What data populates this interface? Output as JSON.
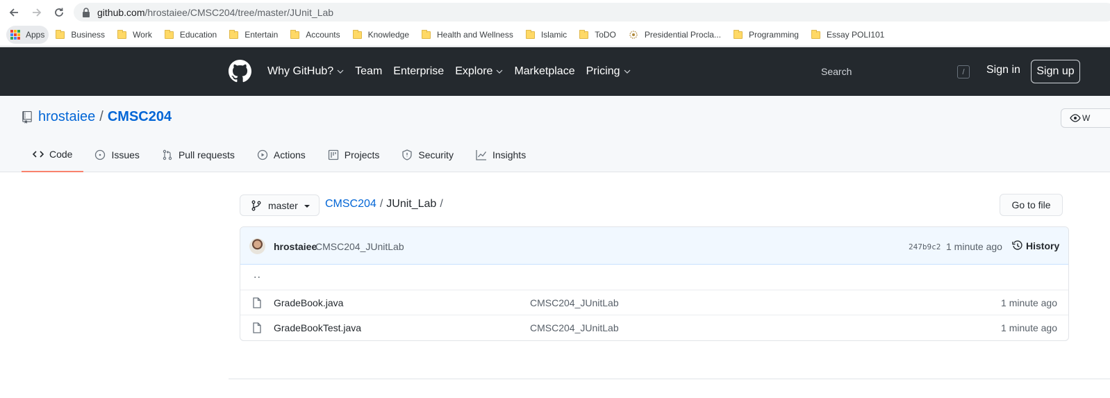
{
  "browser": {
    "url_host": "github.com",
    "url_path": "/hrostaiee/CMSC204/tree/master/JUnit_Lab",
    "bookmarks": [
      {
        "label": "Apps",
        "type": "apps"
      },
      {
        "label": "Business",
        "type": "folder"
      },
      {
        "label": "Work",
        "type": "folder"
      },
      {
        "label": "Education",
        "type": "folder"
      },
      {
        "label": "Entertain",
        "type": "folder"
      },
      {
        "label": "Accounts",
        "type": "folder"
      },
      {
        "label": "Knowledge",
        "type": "folder"
      },
      {
        "label": "Health and Wellness",
        "type": "folder"
      },
      {
        "label": "Islamic",
        "type": "folder"
      },
      {
        "label": "ToDO",
        "type": "folder"
      },
      {
        "label": "Presidential Procla...",
        "type": "site"
      },
      {
        "label": "Programming",
        "type": "folder"
      },
      {
        "label": "Essay POLI101",
        "type": "folder"
      }
    ]
  },
  "header": {
    "nav": [
      {
        "label": "Why GitHub?",
        "dropdown": true
      },
      {
        "label": "Team",
        "dropdown": false
      },
      {
        "label": "Enterprise",
        "dropdown": false
      },
      {
        "label": "Explore",
        "dropdown": true
      },
      {
        "label": "Marketplace",
        "dropdown": false
      },
      {
        "label": "Pricing",
        "dropdown": true
      }
    ],
    "search_placeholder": "Search",
    "search_shortcut": "/",
    "sign_in": "Sign in",
    "sign_up": "Sign up"
  },
  "repo": {
    "owner": "hrostaiee",
    "separator": "/",
    "name": "CMSC204",
    "watch_label": "W",
    "tabs": [
      {
        "label": "Code",
        "icon": "code-icon",
        "active": true
      },
      {
        "label": "Issues",
        "icon": "issue-icon",
        "active": false
      },
      {
        "label": "Pull requests",
        "icon": "pull-request-icon",
        "active": false
      },
      {
        "label": "Actions",
        "icon": "play-icon",
        "active": false
      },
      {
        "label": "Projects",
        "icon": "project-icon",
        "active": false
      },
      {
        "label": "Security",
        "icon": "shield-icon",
        "active": false
      },
      {
        "label": "Insights",
        "icon": "graph-icon",
        "active": false
      }
    ]
  },
  "browser_files": {
    "branch": "master",
    "breadcrumb_root": "CMSC204",
    "breadcrumb_sep": "/",
    "breadcrumb_current": "JUnit_Lab",
    "breadcrumb_trailing": "/",
    "go_to_file": "Go to file",
    "commit": {
      "author": "hrostaiee",
      "message": "CMSC204_JUnitLab",
      "sha": "247b9c2",
      "age": "1 minute ago",
      "history_label": "History"
    },
    "up_dir": "..",
    "files": [
      {
        "name": "GradeBook.java",
        "commit": "CMSC204_JUnitLab",
        "age": "1 minute ago"
      },
      {
        "name": "GradeBookTest.java",
        "commit": "CMSC204_JUnitLab",
        "age": "1 minute ago"
      }
    ]
  },
  "colors": {
    "header_bg": "#24292e",
    "link": "#0366d6",
    "tab_active_underline": "#f9826c",
    "commit_bar_bg": "#f1f8ff",
    "folder": "#ffd966"
  }
}
